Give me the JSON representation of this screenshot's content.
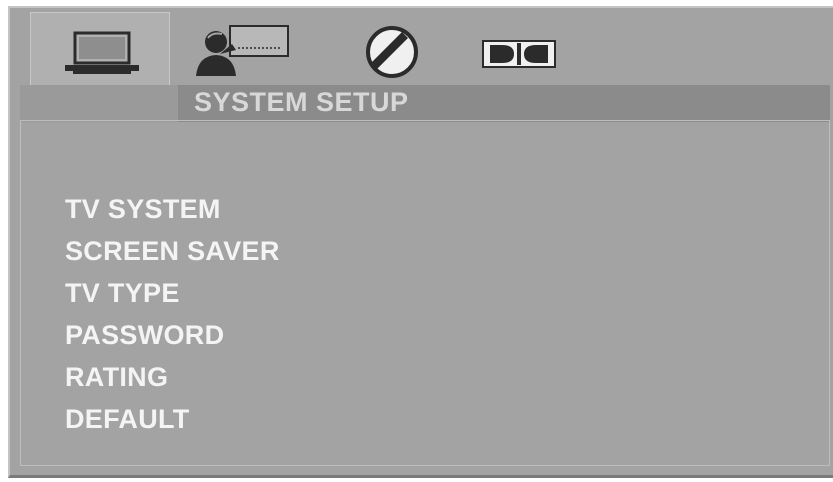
{
  "header": {
    "tabs": [
      {
        "icon": "monitor-icon",
        "label": "System",
        "active": true
      },
      {
        "icon": "speaker-language-icon",
        "label": "Language",
        "active": false
      },
      {
        "icon": "audio-slash-icon",
        "label": "Audio",
        "active": false
      },
      {
        "icon": "dolby-icon",
        "label": "Dolby",
        "active": false
      }
    ],
    "title": "SYSTEM SETUP"
  },
  "menu": {
    "items": [
      "TV SYSTEM",
      "SCREEN SAVER",
      "TV TYPE",
      "PASSWORD",
      "RATING",
      "DEFAULT"
    ]
  },
  "colors": {
    "background": "#a3a3a3",
    "title_bar": "#8b8b8b",
    "title_text": "#d8d8d8",
    "menu_text": "#f4f4f4",
    "icon": "#2b2b2b"
  }
}
